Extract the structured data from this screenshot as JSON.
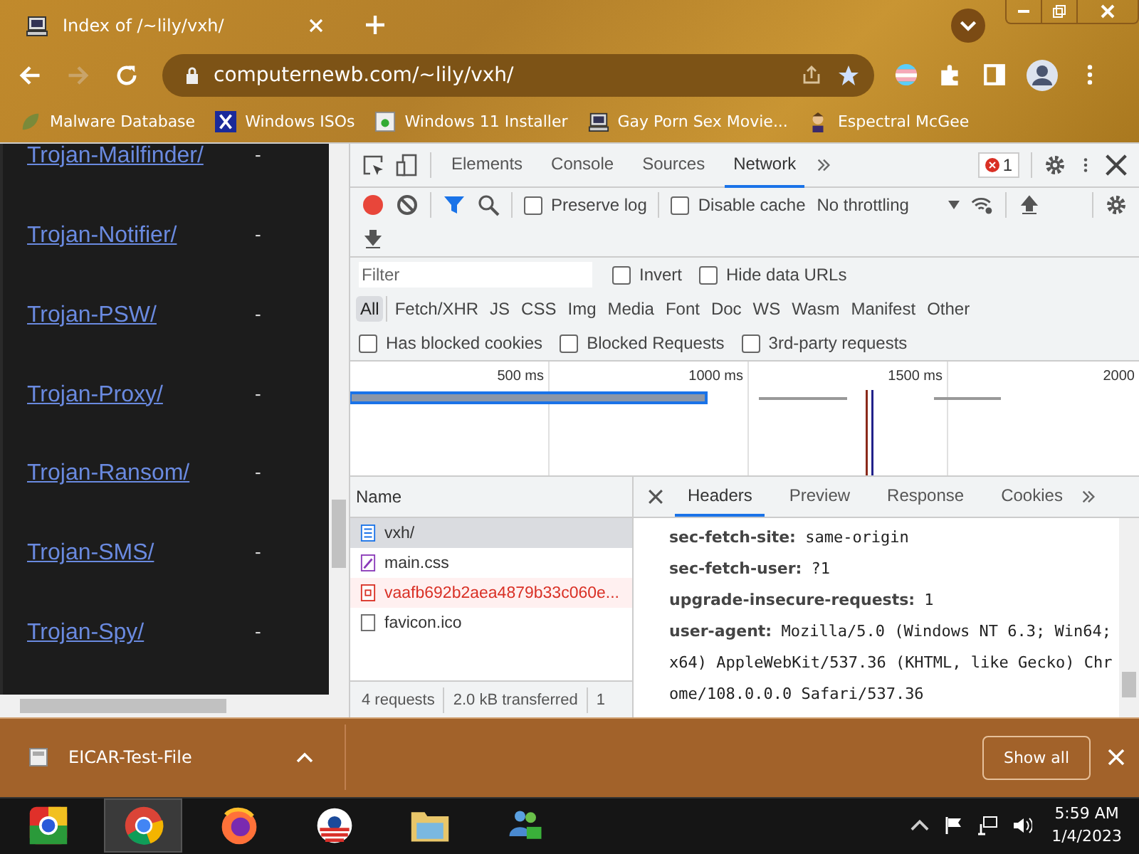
{
  "window": {
    "tab_title": "Index of /~lily/vxh/",
    "address": "computernewb.com/~lily/vxh/"
  },
  "bookmarks": [
    {
      "label": "Malware Database"
    },
    {
      "label": "Windows ISOs"
    },
    {
      "label": "Windows 11 Installer"
    },
    {
      "label": "Gay Porn Sex Movie..."
    },
    {
      "label": "Espectral McGee"
    }
  ],
  "page": {
    "rows": [
      {
        "link": "Trojan-Mailfinder/",
        "size": "-"
      },
      {
        "link": "Trojan-Notifier/",
        "size": "-"
      },
      {
        "link": "Trojan-PSW/",
        "size": "-"
      },
      {
        "link": "Trojan-Proxy/",
        "size": "-"
      },
      {
        "link": "Trojan-Ransom/",
        "size": "-"
      },
      {
        "link": "Trojan-SMS/",
        "size": "-"
      },
      {
        "link": "Trojan-Spy/",
        "size": "-"
      }
    ]
  },
  "devtools": {
    "tabs": [
      {
        "label": "Elements",
        "selected": false
      },
      {
        "label": "Console",
        "selected": false
      },
      {
        "label": "Sources",
        "selected": false
      },
      {
        "label": "Network",
        "selected": true
      }
    ],
    "error_count": "1",
    "preserve_log": {
      "label": "Preserve log",
      "checked": false
    },
    "disable_cache": {
      "label": "Disable cache",
      "checked": false
    },
    "throttling": "No throttling",
    "filter": {
      "placeholder": "Filter"
    },
    "filter_options": [
      {
        "label": "Invert",
        "checked": false
      },
      {
        "label": "Hide data URLs",
        "checked": false
      }
    ],
    "type_filters": [
      {
        "label": "All",
        "selected": true
      },
      {
        "label": "Fetch/XHR",
        "selected": false
      },
      {
        "label": "JS",
        "selected": false
      },
      {
        "label": "CSS",
        "selected": false
      },
      {
        "label": "Img",
        "selected": false
      },
      {
        "label": "Media",
        "selected": false
      },
      {
        "label": "Font",
        "selected": false
      },
      {
        "label": "Doc",
        "selected": false
      },
      {
        "label": "WS",
        "selected": false
      },
      {
        "label": "Wasm",
        "selected": false
      },
      {
        "label": "Manifest",
        "selected": false
      },
      {
        "label": "Other",
        "selected": false
      }
    ],
    "blocked_options": [
      {
        "label": "Has blocked cookies",
        "checked": false
      },
      {
        "label": "Blocked Requests",
        "checked": false
      },
      {
        "label": "3rd-party requests",
        "checked": false
      }
    ],
    "timeline_ticks": [
      "500 ms",
      "1000 ms",
      "1500 ms",
      "2000"
    ],
    "requests_header": "Name",
    "requests": [
      {
        "name": "vxh/",
        "kind": "document",
        "selected": true,
        "failed": false
      },
      {
        "name": "main.css",
        "kind": "stylesheet",
        "selected": false,
        "failed": false
      },
      {
        "name": "vaafb692b2aea4879b33c060e...",
        "kind": "image",
        "selected": false,
        "failed": true
      },
      {
        "name": "favicon.ico",
        "kind": "other",
        "selected": false,
        "failed": false
      }
    ],
    "status": [
      "4 requests",
      "2.0 kB transferred",
      "1"
    ],
    "detail_tabs": [
      {
        "label": "Headers",
        "selected": true
      },
      {
        "label": "Preview",
        "selected": false
      },
      {
        "label": "Response",
        "selected": false
      },
      {
        "label": "Cookies",
        "selected": false
      }
    ],
    "headers": [
      {
        "name": "sec-fetch-site:",
        "value": "same-origin"
      },
      {
        "name": "sec-fetch-user:",
        "value": "?1"
      },
      {
        "name": "upgrade-insecure-requests:",
        "value": "1"
      },
      {
        "name": "user-agent:",
        "value": "Mozilla/5.0 (Windows NT 6.3; Win64; x64) AppleWebKit/537.36 (KHTML, like Gecko) Chrome/108.0.0.0 Safari/537.36"
      }
    ]
  },
  "download": {
    "file": "EICAR-Test-File",
    "show_all": "Show all"
  },
  "taskbar": {
    "apps": [
      {
        "kind": "chrome-beta",
        "selected": false
      },
      {
        "kind": "chrome",
        "selected": true
      },
      {
        "kind": "firefox",
        "selected": false
      },
      {
        "kind": "ring",
        "selected": false
      },
      {
        "kind": "folder",
        "selected": false
      },
      {
        "kind": "messenger",
        "selected": false
      }
    ],
    "time": "5:59 AM",
    "date": "1/4/2023"
  }
}
